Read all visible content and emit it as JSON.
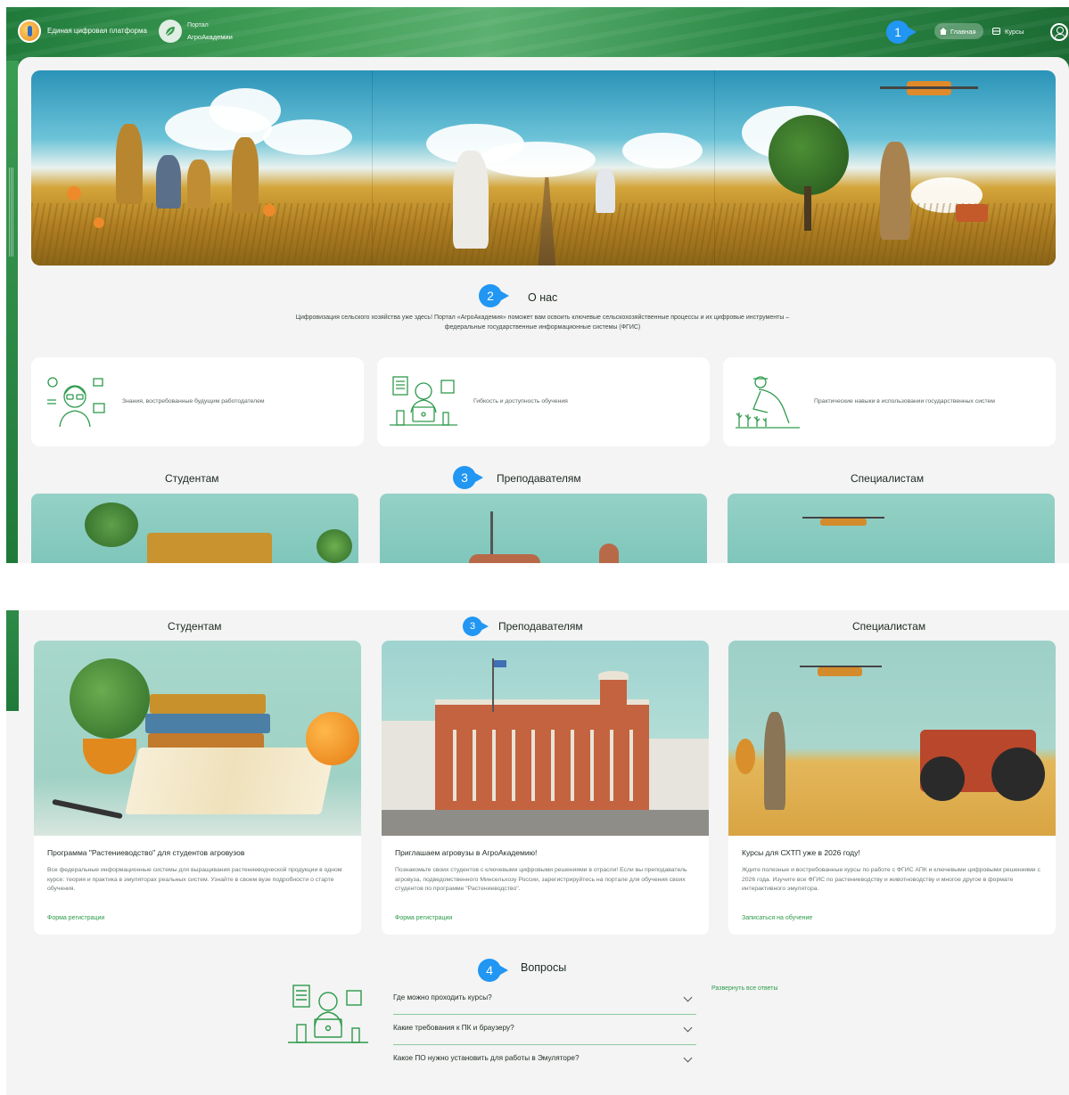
{
  "header": {
    "platform_name": "Единая цифровая платформа",
    "portal_small": "Портал",
    "portal_name": "АгроАкадемии",
    "nav_home": "Главная",
    "nav_courses": "Курсы"
  },
  "callouts": {
    "c1": "1",
    "c2": "2",
    "c3": "3",
    "c4": "4"
  },
  "about": {
    "title": "О нас",
    "text": "Цифровизация сельского хозяйства уже здесь! Портал «АгроАкадемия» поможет вам освоить ключевые сельскохозяйственные процессы и их цифровые инструменты – федеральные государственные информационные системы (ФГИС)"
  },
  "features": [
    {
      "text": "Знания, востребованные будущим работодателем",
      "icon": "employee-skills-icon"
    },
    {
      "text": "Гибкость и доступность обучения",
      "icon": "online-learning-icon"
    },
    {
      "text": "Практические навыки в использовании государственных систем",
      "icon": "farmer-plants-icon"
    }
  ],
  "columns": {
    "students": "Студентам",
    "teachers": "Преподавателям",
    "specialists": "Специалистам"
  },
  "cards": [
    {
      "title": "Программа \"Растениеводство\" для студентов агровузов",
      "text": "Все федеральные информационные системы для выращивания растениеводческой продукции в одном курсе: теория и практика в эмуляторах реальных систем. Узнайте в своем вузе подробности о старте обучения.",
      "link": "Форма регистрации"
    },
    {
      "title": "Приглашаем агровузы в АгроАкадемию!",
      "text": "Познакомьте своих студентов с ключевыми цифровыми решениями в отрасли! Если вы преподаватель агровуза, подведомственного Минсельхозу России, зарегистрируйтесь на портале для обучения своих студентов по программе \"Растениеводство\".",
      "link": "Форма регистрации"
    },
    {
      "title": "Курсы для СХТП уже в 2026 году!",
      "text": "Ждите полезные и востребованные курсы по работе с ФГИС АПК и ключевыми цифровыми решениями с 2026 года. Изучите все ФГИС по растениеводству и животноводству и многое другое в формате интерактивного эмулятора.",
      "link": "Записаться на обучение"
    }
  ],
  "faq": {
    "title": "Вопросы",
    "expand_all": "Развернуть все ответы",
    "items": [
      "Где можно проходить курсы?",
      "Какие требования к ПК и браузеру?",
      "Какое ПО нужно установить для работы в Эмуляторе?"
    ]
  },
  "colors": {
    "accent_green": "#2e9a4c",
    "callout_blue": "#2196f3",
    "header_green": "#2d8a47"
  }
}
